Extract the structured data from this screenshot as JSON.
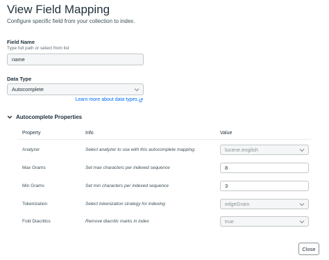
{
  "header": {
    "title": "View Field Mapping",
    "subtitle": "Configure specific field from your collection to index."
  },
  "field_name": {
    "label": "Field Name",
    "hint": "Type full path or select from list",
    "value": "name"
  },
  "data_type": {
    "label": "Data Type",
    "value": "Autocomplete",
    "learn_more": "Learn more about data types"
  },
  "properties": {
    "section_title": "Autocomplete Properties",
    "columns": [
      "Property",
      "Info",
      "Value"
    ],
    "rows": [
      {
        "property": "Analyzer",
        "info": "Select analyzer to use with this autocomplete mapping.",
        "value": "lucene.english",
        "control": "select"
      },
      {
        "property": "Max Grams",
        "info": "Set max characters per indexed sequence",
        "value": "8",
        "control": "input"
      },
      {
        "property": "Min Grams",
        "info": "Set min characters per indexed sequence",
        "value": "3",
        "control": "input"
      },
      {
        "property": "Tokenization",
        "info": "Select tokenization strategy for indexing",
        "value": "edgeGram",
        "control": "select"
      },
      {
        "property": "Fold Diacritics",
        "info": "Remove diacritic marks in index",
        "value": "true",
        "control": "select"
      }
    ]
  },
  "footer": {
    "close_label": "Close"
  },
  "icons": {
    "section_toggle": "chevron-down-icon",
    "select_arrow": "chevron-down-icon",
    "external_link": "external-link-icon"
  },
  "colors": {
    "link": "#016bf8",
    "text": "#21313c",
    "muted": "#889397"
  }
}
